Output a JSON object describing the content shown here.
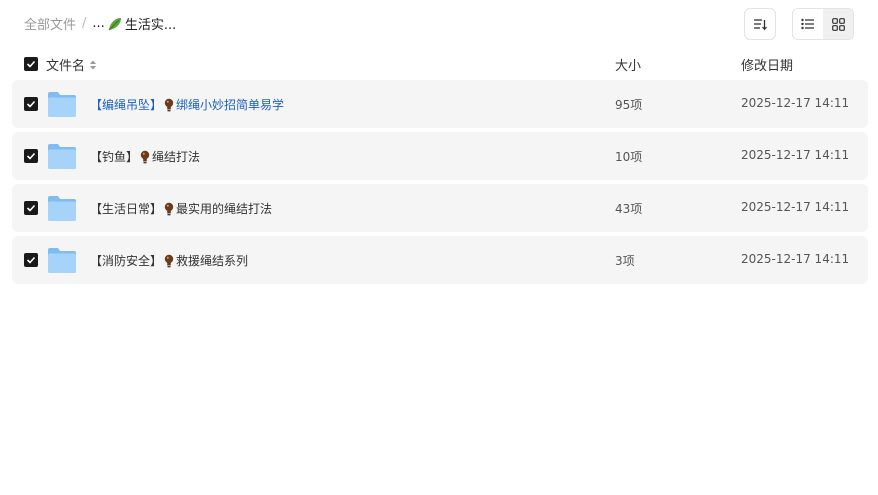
{
  "breadcrumb": {
    "root": "全部文件",
    "separator": "/",
    "ellipsis": "...",
    "current": "生活实...",
    "current_icon": "leaf-icon"
  },
  "toolbar": {
    "sort_icon": "sort-icon",
    "view_list_icon": "list-view-icon",
    "view_grid_icon": "grid-view-icon",
    "active_view": "list"
  },
  "table": {
    "headers": {
      "name": "文件名",
      "size": "大小",
      "date": "修改日期"
    },
    "all_checked": true,
    "rows": [
      {
        "prefix": "【编绳吊坠】",
        "suffix": "绑绳小妙招简单易学",
        "size": "95项",
        "date": "2025-12-17 14:11",
        "checked": true,
        "highlight": true
      },
      {
        "prefix": "【钓鱼】",
        "suffix": "绳结打法",
        "size": "10项",
        "date": "2025-12-17 14:11",
        "checked": true,
        "highlight": false
      },
      {
        "prefix": "【生活日常】",
        "suffix": "最实用的绳结打法",
        "size": "43项",
        "date": "2025-12-17 14:11",
        "checked": true,
        "highlight": false
      },
      {
        "prefix": "【消防安全】",
        "suffix": "救援绳结系列",
        "size": "3项",
        "date": "2025-12-17 14:11",
        "checked": true,
        "highlight": false
      }
    ]
  },
  "colors": {
    "link": "#1d5fc2",
    "row_bg": "#f5f5f5",
    "checkbox": "#1a1a1a",
    "folder": "#8cc4f5"
  }
}
